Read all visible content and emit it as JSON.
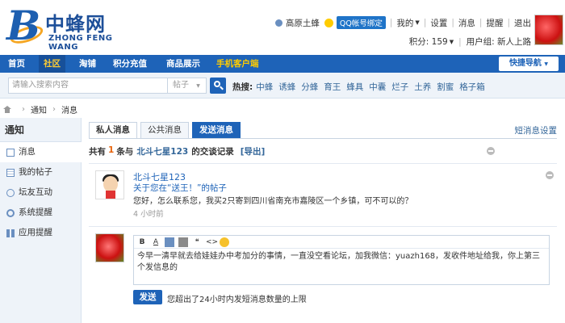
{
  "logo": {
    "cn": "中蜂网",
    "en": "ZHONG FENG WANG"
  },
  "user": {
    "name": "高原土蜂",
    "qq_bind": "QQ帐号绑定",
    "links": [
      "我的",
      "设置",
      "消息",
      "提醒",
      "退出"
    ],
    "points_label": "积分: 159",
    "group_label": "用户组: 新人上路"
  },
  "nav": {
    "items": [
      "首页",
      "社区",
      "淘铺",
      "积分充值",
      "商品展示",
      "手机客户端"
    ],
    "quick": "快捷导航"
  },
  "search": {
    "placeholder": "请输入搜索内容",
    "type": "帖子",
    "hot_label": "热搜:",
    "hot": [
      "中蜂",
      "诱蜂",
      "分蜂",
      "育王",
      "蜂具",
      "中囊",
      "烂子",
      "土养",
      "割蜜",
      "格子箱"
    ]
  },
  "breadcrumb": [
    "通知",
    "消息"
  ],
  "sidebar": {
    "title": "通知",
    "items": [
      "消息",
      "我的帖子",
      "坛友互动",
      "系统提醒",
      "应用提醒"
    ]
  },
  "tabs": [
    "私人消息",
    "公共消息",
    "发送消息"
  ],
  "pm_settings": "短消息设置",
  "summary": {
    "prefix": "共有",
    "count": "1",
    "middle": "条与",
    "contact": "北斗七星123",
    "suffix": "的交谈记录",
    "export": "[导出]"
  },
  "message": {
    "sender": "北斗七星123",
    "subject": "关于您在“送王！”的帖子",
    "text": "您好，怎么联系您，我买2只寄到四川省南充市嘉陵区一个乡镇，可不可以的？",
    "time": "4 小时前"
  },
  "editor": {
    "toolbar": [
      "B",
      "A",
      "",
      "",
      "❝",
      "<>",
      ""
    ],
    "content": "今早一清早就去给娃娃办中考加分的事情，一直没空看论坛，加我微信：yuazh168，发收件地址给我，你上第三个发信息的"
  },
  "send_button": "发送",
  "limit_notice": "您超出了24小时内发短消息数量的上限"
}
